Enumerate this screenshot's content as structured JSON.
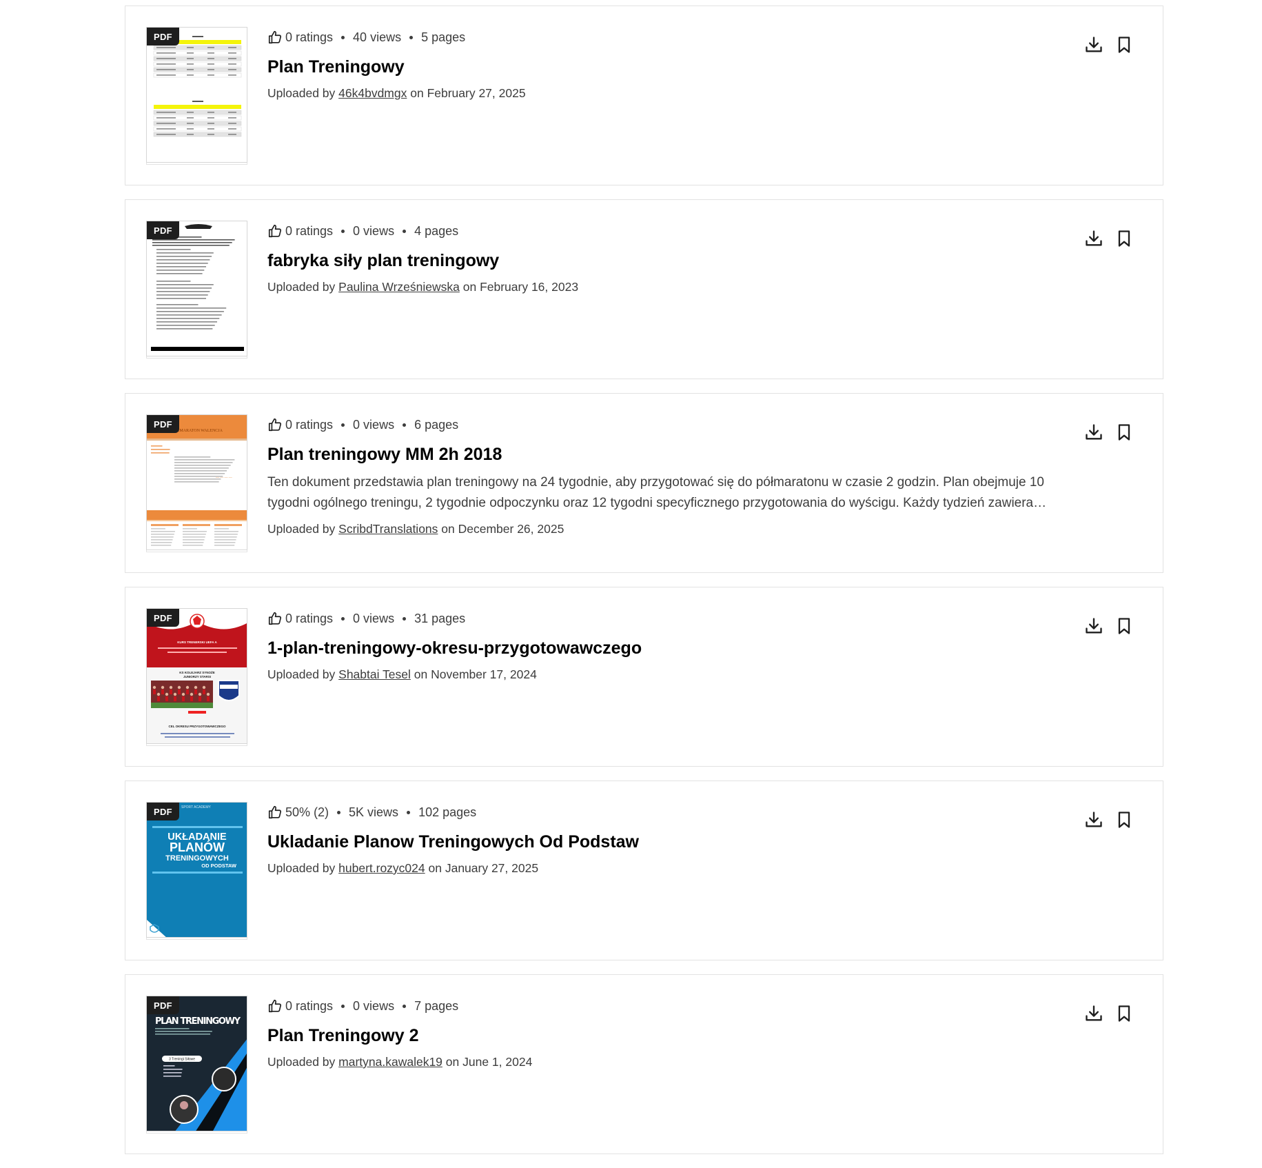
{
  "documents": [
    {
      "badge": "PDF",
      "thumbnail": "table-doc-yellow",
      "rating": "0 ratings",
      "views": "40 views",
      "pages": "5 pages",
      "title": "Plan Treningowy",
      "description": "",
      "uploaded_prefix": "Uploaded by ",
      "uploader": "46k4bvdmgx",
      "uploaded_suffix": " on February 27, 2025"
    },
    {
      "badge": "PDF",
      "thumbnail": "text-doc",
      "rating": "0 ratings",
      "views": "0 views",
      "pages": "4 pages",
      "title": "fabryka siły plan treningowy",
      "description": "",
      "uploaded_prefix": "Uploaded by ",
      "uploader": "Paulina Wrześniewska",
      "uploaded_suffix": " on February 16, 2023"
    },
    {
      "badge": "PDF",
      "thumbnail": "orange-doc",
      "rating": "0 ratings",
      "views": "0 views",
      "pages": "6 pages",
      "title": "Plan treningowy MM 2h 2018",
      "description": "Ten dokument przedstawia plan treningowy na 24 tygodnie, aby przygotować się do półmaratonu w czasie 2 godzin. Plan obejmuje 10 tygodni ogólnego treningu, 2 tygodnie odpoczynku oraz 12 tygodni specyficznego przygotowania do wyścigu. Każdy tydzień zawiera szczegółowe wskazówki dotyczące treningu.",
      "uploaded_prefix": "Uploaded by ",
      "uploader": "ScribdTranslations",
      "uploaded_suffix": " on December 26, 2025"
    },
    {
      "badge": "PDF",
      "thumbnail": "football-doc",
      "rating": "0 ratings",
      "views": "0 views",
      "pages": "31 pages",
      "title": "1-plan-treningowy-okresu-przygotowawczego",
      "description": "",
      "uploaded_prefix": "Uploaded by ",
      "uploader": "Shabtai Tesel",
      "uploaded_suffix": " on November 17, 2024"
    },
    {
      "badge": "PDF",
      "thumbnail": "blue-cover",
      "rating": "50% (2)",
      "views": "5K views",
      "pages": "102 pages",
      "title": "Ukladanie Planow Treningowych Od Podstaw",
      "description": "",
      "uploaded_prefix": "Uploaded by ",
      "uploader": "hubert.rozyc024",
      "uploaded_suffix": " on January 27, 2025"
    },
    {
      "badge": "PDF",
      "thumbnail": "dark-cover",
      "rating": "0 ratings",
      "views": "0 views",
      "pages": "7 pages",
      "title": "Plan Treningowy 2",
      "description": "",
      "uploaded_prefix": "Uploaded by ",
      "uploader": "martyna.kawalek19",
      "uploaded_suffix": " on June 1, 2024"
    }
  ],
  "thumb_texts": {
    "blue_cover_header": "SPORT ACADEMY",
    "blue_cover_line1": "UKŁADANIE",
    "blue_cover_line2": "PLANÓW",
    "blue_cover_line3": "TRENINGOWYCH",
    "blue_cover_line4": "OD PODSTAW",
    "dark_cover_title": "PLAN TRENINGOWY",
    "dark_cover_tag": "3 Treningi Siłowe",
    "football_header": "KURS TRENERSKI UEFA A",
    "football_sub": "KS KOLEJARZ SYNOŻE",
    "football_sub2": "JUNIORZY STARSI",
    "football_footer": "CEL OKRESU PRZYGOTOWAWCZEGO",
    "orange_title": "PÓŁMARATON WALENCJA"
  },
  "colors": {
    "accent_blue": "#0f7fb5",
    "orange": "#ec8a3c",
    "red": "#c0141c",
    "dark": "#1e1e1e"
  }
}
